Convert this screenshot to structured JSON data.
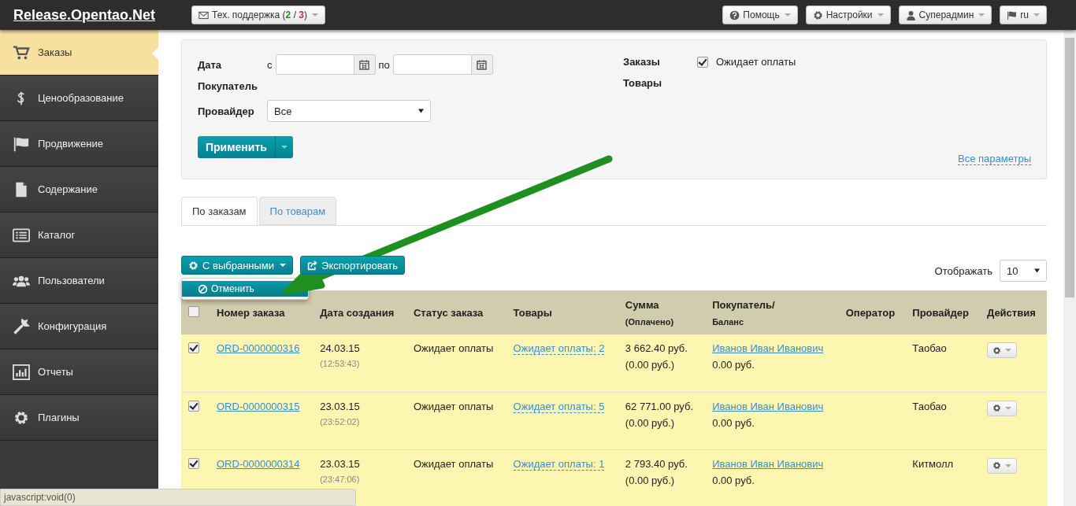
{
  "topbar": {
    "logo": "Release.Opentao.Net",
    "support": {
      "label": "Тех. поддержка (",
      "open": "2",
      "separator": " / ",
      "total": "3",
      "close": ")"
    },
    "menus": [
      {
        "kind": "help",
        "label": "Помощь"
      },
      {
        "kind": "gears",
        "label": "Настройки"
      },
      {
        "kind": "user",
        "label": "Суперадмин"
      },
      {
        "kind": "flag",
        "label": "ru"
      }
    ]
  },
  "sidebar": {
    "items": [
      {
        "kind": "cart",
        "label": "Заказы",
        "selected": true
      },
      {
        "kind": "dollar",
        "label": "Ценообразование",
        "selected": false
      },
      {
        "kind": "flag",
        "label": "Продвижение",
        "selected": false
      },
      {
        "kind": "file",
        "label": "Содержание",
        "selected": false
      },
      {
        "kind": "list",
        "label": "Каталог",
        "selected": false
      },
      {
        "kind": "users",
        "label": "Пользователи",
        "selected": false
      },
      {
        "kind": "wrench",
        "label": "Конфигурация",
        "selected": false
      },
      {
        "kind": "chart",
        "label": "Отчеты",
        "selected": false
      },
      {
        "kind": "gear",
        "label": "Плагины",
        "selected": false
      }
    ]
  },
  "filter": {
    "date_label": "Дата",
    "from_label": "с",
    "to_label": "по",
    "buyer_label": "Покупатель",
    "provider_label": "Провайдер",
    "provider_value": "Все",
    "orders_label": "Заказы",
    "goods_label": "Товары",
    "awaiting": {
      "label": "Ожидает оплаты",
      "checked": true
    },
    "apply_button": "Применить",
    "all_params_link": "Все параметры"
  },
  "tabs": [
    {
      "label": "По заказам",
      "selected": true
    },
    {
      "label": "По товарам",
      "selected": false
    }
  ],
  "toolbar": {
    "bulk_button": "С выбранными",
    "export_button": "Экспортировать",
    "bulk_menu": [
      {
        "label": "Отменить"
      }
    ],
    "page_size_label": "Отображать",
    "page_size_value": "10"
  },
  "table": {
    "select_all": {
      "checked": false
    },
    "columns": [
      {
        "label": "Номер заказа"
      },
      {
        "label": "Дата создания"
      },
      {
        "label": "Статус заказа"
      },
      {
        "label": "Товары"
      },
      {
        "label": "Сумма",
        "sub": "(Оплачено)"
      },
      {
        "label": "Покупатель/",
        "sub": "Баланс"
      },
      {
        "label": "Оператор"
      },
      {
        "label": "Провайдер"
      },
      {
        "label": "Действия"
      }
    ],
    "rows": [
      {
        "checked": true,
        "order": "ORD-0000000316",
        "date": "24.03.15",
        "time": "(12:53:43)",
        "status": "Ожидает оплаты",
        "goods": "Ожидает оплаты: 2",
        "sum": "3 662.40 руб.",
        "paid": "(0.00 руб.)",
        "buyer": "Иванов Иван Иванович",
        "balance": "0.00 руб.",
        "provider": "Таобао"
      },
      {
        "checked": true,
        "order": "ORD-0000000315",
        "date": "23.03.15",
        "time": "(23:52:02)",
        "status": "Ожидает оплаты",
        "goods": "Ожидает оплаты: 5",
        "sum": "62 771.00 руб.",
        "paid": "(0.00 руб.)",
        "buyer": "Иванов Иван Иванович",
        "balance": "0.00 руб.",
        "provider": "Таобао"
      },
      {
        "checked": true,
        "order": "ORD-0000000314",
        "date": "23.03.15",
        "time": "(23:47:06)",
        "status": "Ожидает оплаты",
        "goods": "Ожидает оплаты: 1",
        "sum": "2 793.40 руб.",
        "paid": "(0.00 руб.)",
        "buyer": "Иванов Иван Иванович",
        "balance": "0.00 руб.",
        "provider": "Китмолл"
      }
    ]
  },
  "status_bar": "javascript:void(0)"
}
